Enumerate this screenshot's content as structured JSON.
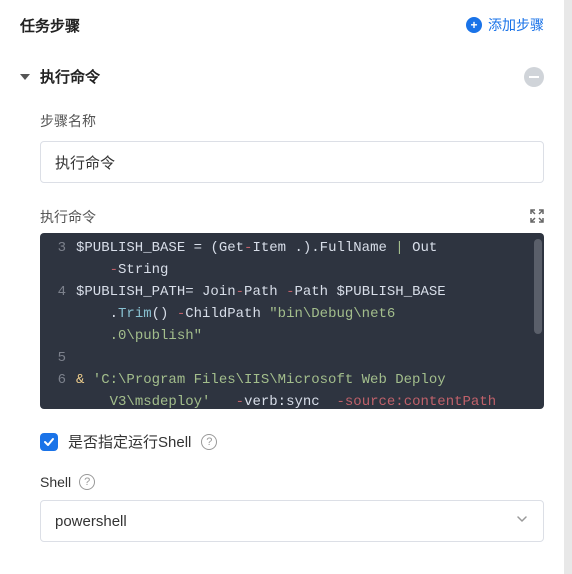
{
  "header": {
    "title": "任务步骤",
    "add_step_label": "添加步骤"
  },
  "step": {
    "title": "执行命令",
    "name_label": "步骤名称",
    "name_value": "执行命令",
    "code_label": "执行命令",
    "lines": [
      {
        "n": "3",
        "type": "assign_base"
      },
      {
        "n": "",
        "type": "wrap_outstring"
      },
      {
        "n": "4",
        "type": "assign_path"
      },
      {
        "n": "",
        "type": "wrap_trim"
      },
      {
        "n": "",
        "type": "wrap_dotpath"
      },
      {
        "n": "5",
        "type": "blank"
      },
      {
        "n": "6",
        "type": "amp_path"
      },
      {
        "n": "",
        "type": "wrap_verb"
      }
    ],
    "code": {
      "publish_base_var": "$PUBLISH_BASE",
      "eq": " = ",
      "getitem": "(Get",
      "item_tail": "Item .).FullName",
      "out": "Out",
      "string": "String",
      "publish_path_var": "$PUBLISH_PATH",
      "eq2": "= ",
      "join": "Join",
      "path1": "Path ",
      "pathflag": "Path ",
      "trim": "Trim",
      "paren": "() ",
      "childpath": "ChildPath ",
      "childpath_val": "\"bin\\Debug\\net6",
      "childpath_val2": ".0\\publish\"",
      "amp": "&",
      "iis_path": " 'C:\\Program Files\\IIS\\Microsoft Web Deploy",
      "v3": "V3\\msdeploy'",
      "verb": "verb:sync ",
      "source": "source:contentPath"
    },
    "specify_shell_label": "是否指定运行Shell",
    "shell_label": "Shell",
    "shell_value": "powershell"
  }
}
